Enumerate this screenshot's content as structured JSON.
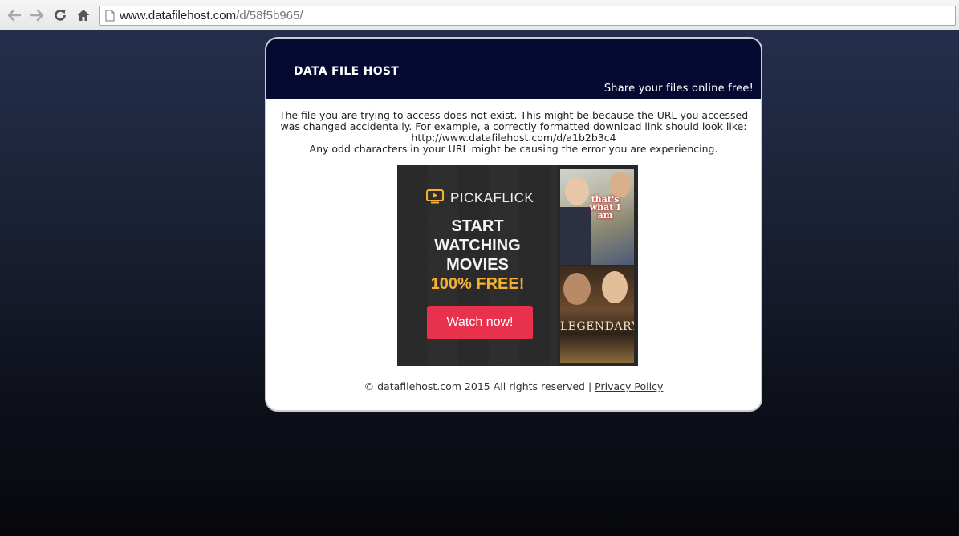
{
  "browser": {
    "url_domain": "www.datafilehost.com",
    "url_path": "/d/58f5b965/"
  },
  "header": {
    "site_title": "DATA FILE HOST",
    "tagline": "Share your files online free!"
  },
  "message": {
    "line1": "The file you are trying to access does not exist. This might be because the URL you accessed",
    "line2": "was changed accidentally. For example, a correctly formatted download link should look like:",
    "line3": "http://www.datafilehost.com/d/a1b2b3c4",
    "line4": "Any odd characters in your URL might be causing the error you are experiencing."
  },
  "ad": {
    "brand": "PICKAFLICK",
    "headline_line1": "START",
    "headline_line2": "WATCHING",
    "headline_line3": "MOVIES",
    "headline_line4": "100% FREE!",
    "cta_label": "Watch now!",
    "poster1_title": "that's what I am",
    "poster2_title": "LEGENDARY",
    "colors": {
      "cta": "#e8314d",
      "highlight": "#f4b133"
    }
  },
  "footer": {
    "copyright": "© datafilehost.com 2015 All rights reserved",
    "separator": "|",
    "privacy_link": "Privacy Policy"
  },
  "colors": {
    "header_bg": "#050830",
    "page_bg_top": "#26314f",
    "page_bg_bottom": "#07080c"
  }
}
